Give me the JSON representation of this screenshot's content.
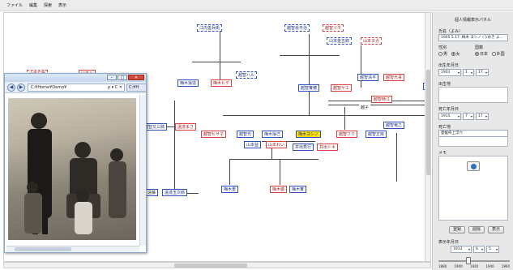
{
  "menubar": {
    "items": [
      "ファイル",
      "編集",
      "探索",
      "表示"
    ]
  },
  "tree": {
    "nodes": [
      {
        "label": "江内善兵衛",
        "k": "md"
      },
      {
        "label": "越智余平治",
        "k": "md"
      },
      {
        "label": "越智ツネ",
        "k": "fd"
      },
      {
        "label": "山本金五郎",
        "k": "md"
      },
      {
        "label": "山本ヌガ",
        "k": "fd"
      },
      {
        "label": "山本右衛",
        "k": "fd"
      },
      {
        "label": "山本ト",
        "k": "f"
      },
      {
        "label": "越智ハル",
        "k": "md"
      },
      {
        "label": "梅木捨造",
        "k": "m"
      },
      {
        "label": "梅木ヒデ",
        "k": "f"
      },
      {
        "label": "越智實穂",
        "k": "m"
      },
      {
        "label": "越智ヤエ",
        "k": "f"
      },
      {
        "label": "越智清平",
        "k": "m"
      },
      {
        "label": "越智光喜",
        "k": "f"
      },
      {
        "label": "越智時江",
        "k": "f"
      },
      {
        "label": "越智又三郎",
        "k": "m"
      },
      {
        "label": "遠達まさ",
        "k": "f"
      },
      {
        "label": "越智ヒサ子",
        "k": "f"
      },
      {
        "label": "越智光",
        "k": "m"
      },
      {
        "label": "梅木捨己",
        "k": "m"
      },
      {
        "label": "梅木ヨシノ",
        "k": "sel"
      },
      {
        "label": "越智フミ",
        "k": "f"
      },
      {
        "label": "越智正房",
        "k": "m"
      },
      {
        "label": "越智竜之",
        "k": "m"
      },
      {
        "label": "山本益",
        "k": "m"
      },
      {
        "label": "山本わい",
        "k": "f"
      },
      {
        "label": "井出秀行",
        "k": "m"
      },
      {
        "label": "井出トキ",
        "k": "f"
      },
      {
        "label": "遠達玉次郎",
        "k": "m"
      },
      {
        "label": "梅木重",
        "k": "m"
      },
      {
        "label": "梅木盛",
        "k": "f"
      },
      {
        "label": "梅木實",
        "k": "m"
      }
    ],
    "fragments": [
      "越子",
      "遠藤"
    ]
  },
  "browser": {
    "address": "C:¥Home¥Demo¥",
    "address_icons": "ρ ▾ C ✕",
    "second_tab": "C:¥H",
    "buttons": [
      "–",
      "□",
      "✕"
    ]
  },
  "panel": {
    "title": "個人情報表示パネル",
    "name_label": "氏名（よみ）",
    "name_value": "1905.5.17: 梅木 ヨシノ (うめき よ...",
    "sex_label": "性別",
    "sex_options": [
      "男",
      "女"
    ],
    "sex_selected": "女",
    "nation_label": "国籍",
    "nation_options": [
      "日本",
      "外国"
    ],
    "nation_selected": "日本",
    "birth_label": "出生年月日",
    "birth_year": "1901",
    "birth_month": "1",
    "birth_day": "17",
    "birthplace_label": "出生地",
    "death_label": "死亡年月日",
    "death_year": "1915",
    "death_month": "7",
    "death_day": "17",
    "deathplace_label": "死亡地",
    "deathplace_value": "愛媛県上浮穴",
    "memo_label": "メモ",
    "buttons": [
      "登録",
      "削除",
      "表示"
    ],
    "display_label": "表示年月日",
    "display_year": "1913",
    "display_month": "6",
    "display_day": "5",
    "slider_ticks": [
      "1880",
      "1900",
      "1920",
      "1940",
      "1960"
    ],
    "slider_value_year": 1913
  }
}
